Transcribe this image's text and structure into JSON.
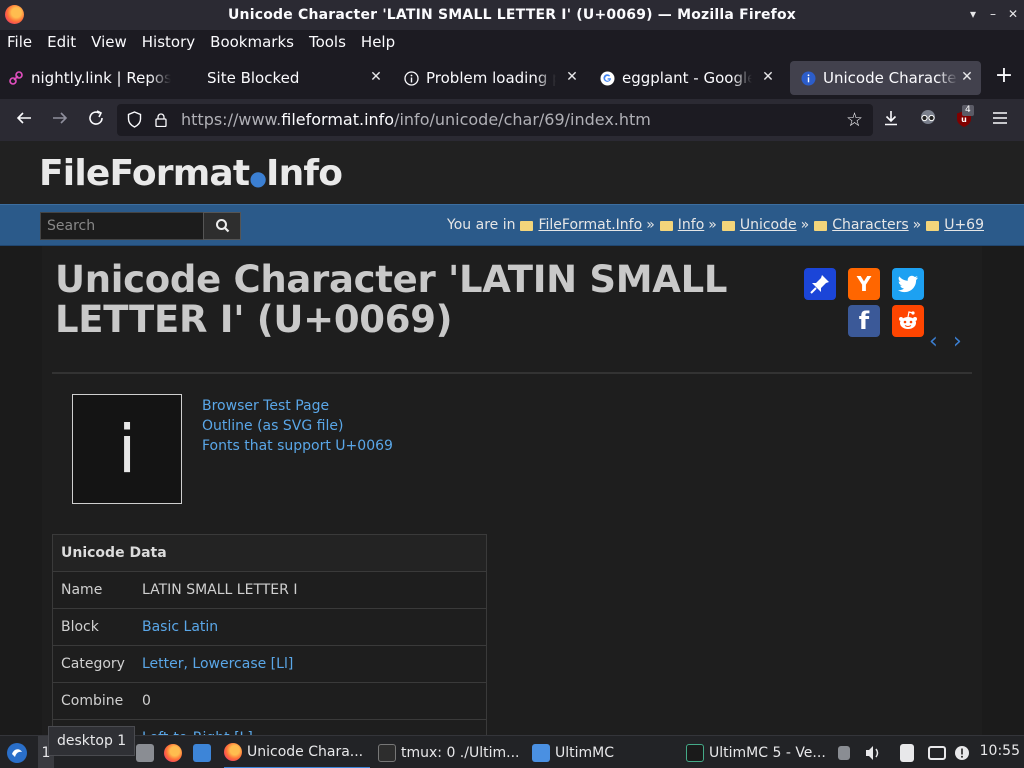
{
  "window": {
    "title": "Unicode Character 'LATIN SMALL LETTER I' (U+0069) — Mozilla Firefox",
    "controls": [
      "▾",
      "–",
      "✕"
    ]
  },
  "menu": [
    "File",
    "Edit",
    "View",
    "History",
    "Bookmarks",
    "Tools",
    "Help"
  ],
  "tabs": [
    {
      "label": "nightly.link | Repos",
      "favicon": "link-icon"
    },
    {
      "label": "Site Blocked",
      "favicon": ""
    },
    {
      "label": "Problem loading page",
      "favicon": "info-icon"
    },
    {
      "label": "eggplant - Google Se",
      "favicon": "google-icon"
    },
    {
      "label": "Unicode Character",
      "favicon": "info-icon",
      "active": true
    }
  ],
  "nav": {
    "url_prefix": "https://www.",
    "url_host": "fileformat.info",
    "url_path": "/info/unicode/char/69/index.htm",
    "extension_badge": "4"
  },
  "site": {
    "logo_a": "FileFormat",
    "logo_b": "Info",
    "search_placeholder": "Search",
    "breadcrumb_prefix": "You are in",
    "breadcrumb": [
      "FileFormat.Info",
      "Info",
      "Unicode",
      "Characters",
      "U+69"
    ]
  },
  "char": {
    "heading": "Unicode Character 'LATIN SMALL LETTER I' (U+0069)",
    "glyph": "i",
    "links": [
      "Browser Test Page",
      "Outline (as SVG file)",
      "Fonts that support U+0069"
    ]
  },
  "unicode_data": {
    "header": "Unicode Data",
    "rows": [
      {
        "key": "Name",
        "value": "LATIN SMALL LETTER I",
        "link": false
      },
      {
        "key": "Block",
        "value": "Basic Latin",
        "link": true
      },
      {
        "key": "Category",
        "value": "Letter, Lowercase [Ll]",
        "link": true
      },
      {
        "key": "Combine",
        "value": "0",
        "link": false
      },
      {
        "key": "",
        "value": "Left-to-Right [L]",
        "link": false
      }
    ]
  },
  "taskbar": {
    "tooltip": "desktop 1",
    "workspace": "1",
    "items": [
      {
        "label": "Unicode Chara..."
      },
      {
        "label": "tmux: 0 ./Ultim..."
      },
      {
        "label": "UltimMC"
      },
      {
        "label": "UltimMC 5 - Ve..."
      }
    ],
    "clock": "10:55"
  },
  "colors": {
    "accent": "#3b7fd2",
    "link": "#5aa7e8",
    "nav_blue": "#2b5a8a",
    "twitter": "#1da1f2",
    "facebook": "#3b5998",
    "reddit": "#ff4500",
    "hackernews": "#ff6600",
    "pinboard": "#0000ff"
  }
}
